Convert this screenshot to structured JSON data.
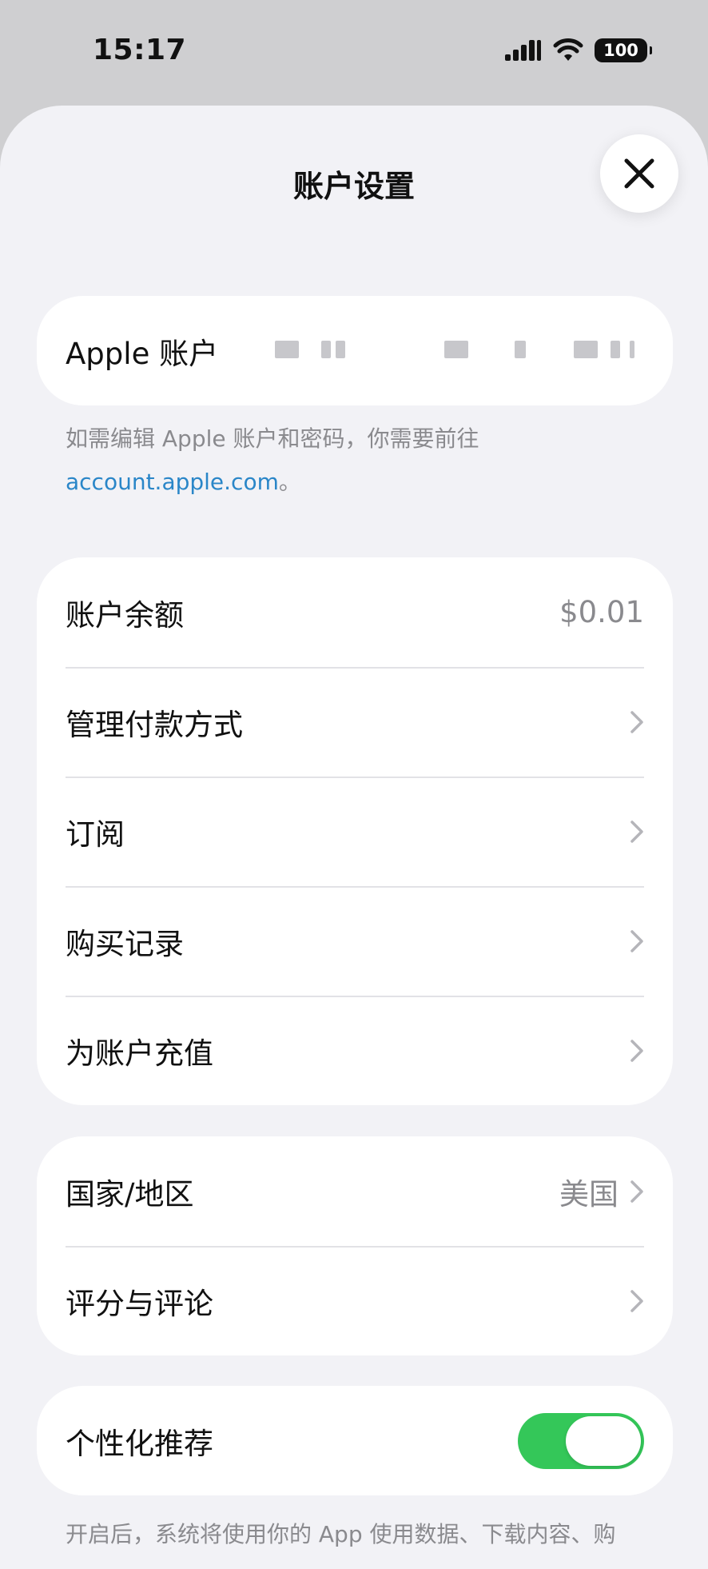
{
  "status_bar": {
    "time": "15:17",
    "battery": "100"
  },
  "sheet": {
    "title": "账户设置"
  },
  "apple_account": {
    "label": "Apple 账户"
  },
  "apple_note": {
    "text": "如需编辑 Apple 账户和密码，你需要前往",
    "link": "account.apple.com",
    "suffix": "。"
  },
  "balance_group": [
    {
      "label": "账户余额",
      "value": "$0.01"
    },
    {
      "label": "管理付款方式"
    },
    {
      "label": "订阅"
    },
    {
      "label": "购买记录"
    },
    {
      "label": "为账户充值"
    }
  ],
  "region_group": [
    {
      "label": "国家/地区",
      "value": "美国"
    },
    {
      "label": "评分与评论"
    }
  ],
  "personalized": {
    "label": "个性化推荐",
    "enabled": true
  },
  "bottom_note": {
    "text": "开启后，系统将使用你的 App 使用数据、下载内容、购"
  },
  "colors": {
    "toggle_on": "#34c759",
    "link": "#2a86c8",
    "sheet_bg": "#f2f2f6"
  }
}
